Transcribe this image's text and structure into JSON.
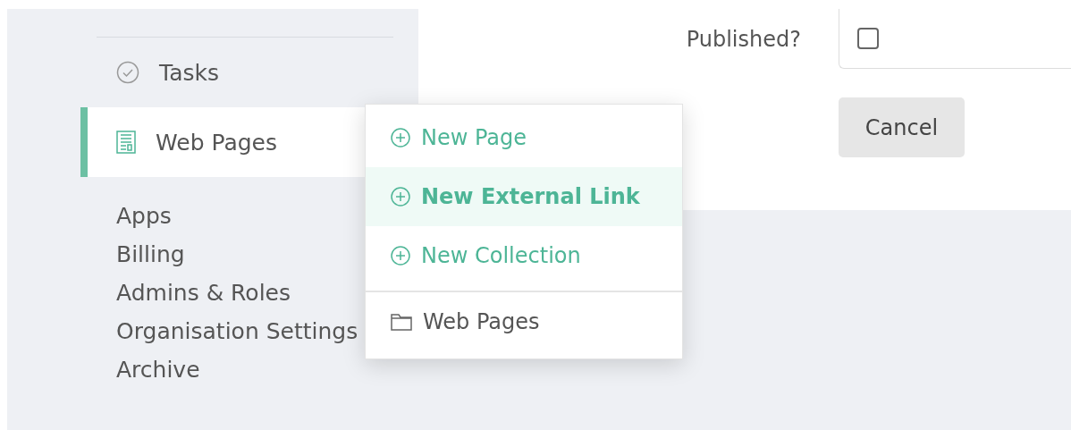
{
  "sidebar": {
    "items": [
      {
        "label": "Tasks",
        "kind": "task",
        "selected": false
      },
      {
        "label": "Web Pages",
        "kind": "page",
        "selected": true
      },
      {
        "label": "Apps",
        "kind": "plain",
        "selected": false
      },
      {
        "label": "Billing",
        "kind": "plain",
        "selected": false
      },
      {
        "label": "Admins & Roles",
        "kind": "plain",
        "selected": false
      },
      {
        "label": "Organisation Settings",
        "kind": "plain",
        "selected": false
      },
      {
        "label": "Archive",
        "kind": "plain",
        "selected": false
      }
    ]
  },
  "form": {
    "published": {
      "label": "Published?",
      "checked": false
    },
    "cancel": "Cancel"
  },
  "menu": {
    "items": [
      {
        "label": "New Page",
        "kind": "action",
        "selected": false
      },
      {
        "label": "New External Link",
        "kind": "action",
        "selected": true
      },
      {
        "label": "New Collection",
        "kind": "action",
        "selected": false
      },
      {
        "label": "Web Pages",
        "kind": "folder",
        "selected": false
      }
    ]
  }
}
